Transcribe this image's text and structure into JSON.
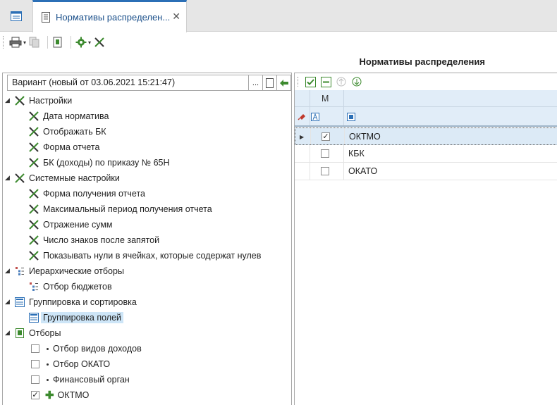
{
  "tabs": {
    "active_title": "Нормативы распределен...",
    "close_glyph": "✕"
  },
  "toolbar": {
    "caret": "▾"
  },
  "section": {
    "title": "Нормативы распределения"
  },
  "variant": {
    "value": "Вариант (новый от 03.06.2021 15:21:47)",
    "dots_label": "..."
  },
  "tree": {
    "settings": {
      "label": "Настройки",
      "items": [
        "Дата норматива",
        "Отображать БК",
        "Форма отчета",
        "БК (доходы) по приказу № 65Н"
      ]
    },
    "system": {
      "label": "Системные настройки",
      "items": [
        "Форма получения отчета",
        "Максимальный период получения отчета",
        "Отражение сумм",
        "Число знаков после запятой",
        "Показывать нули в ячейках, которые содержат нулев"
      ]
    },
    "hier": {
      "label": "Иерархические отборы",
      "items": [
        "Отбор бюджетов"
      ]
    },
    "group": {
      "label": "Группировка и сортировка",
      "items": [
        "Группировка полей"
      ]
    },
    "filters": {
      "label": "Отборы",
      "items": [
        {
          "label": "Отбор видов доходов",
          "checked": false
        },
        {
          "label": "Отбор ОКАТО",
          "checked": false
        },
        {
          "label": "Финансовый орган",
          "checked": false
        },
        {
          "label": "ОКТМО",
          "checked": true
        }
      ]
    }
  },
  "grid": {
    "column_m": "M",
    "rows": [
      {
        "label": "ОКТМО",
        "checked": true,
        "current": true
      },
      {
        "label": "КБК",
        "checked": false,
        "current": false
      },
      {
        "label": "ОКАТО",
        "checked": false,
        "current": false
      }
    ]
  },
  "colors": {
    "accent": "#2b6fb6",
    "grid_header": "#e1edf8",
    "selection": "#cde5f7",
    "tool_green": "#3c8a2e"
  }
}
